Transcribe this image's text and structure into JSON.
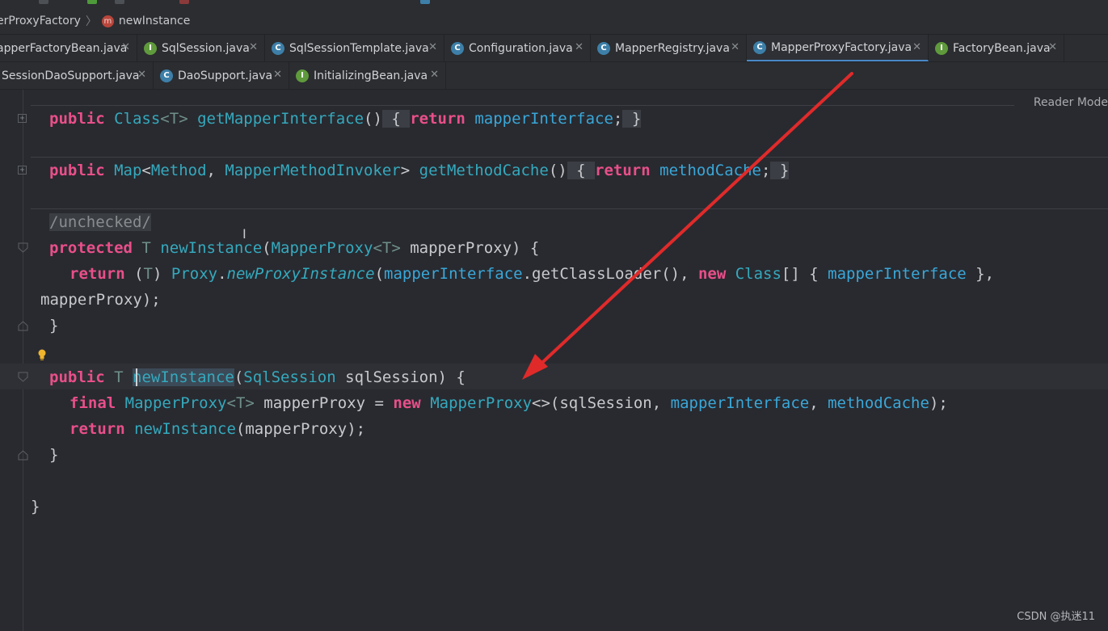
{
  "breadcrumb": {
    "class_name": "erProxyFactory",
    "method_badge": "m",
    "method_name": "newInstance"
  },
  "tabs_row1": [
    {
      "label": "apperFactoryBean.java",
      "icon": "",
      "active": false
    },
    {
      "label": "SqlSession.java",
      "icon": "I",
      "active": false
    },
    {
      "label": "SqlSessionTemplate.java",
      "icon": "C",
      "active": false
    },
    {
      "label": "Configuration.java",
      "icon": "C",
      "active": false
    },
    {
      "label": "MapperRegistry.java",
      "icon": "C",
      "active": false
    },
    {
      "label": "MapperProxyFactory.java",
      "icon": "C",
      "active": true
    },
    {
      "label": "FactoryBean.java",
      "icon": "I",
      "active": false
    }
  ],
  "tabs_row2": [
    {
      "label": "SessionDaoSupport.java",
      "icon": "",
      "active": false
    },
    {
      "label": "DaoSupport.java",
      "icon": "C",
      "active": false
    },
    {
      "label": "InitializingBean.java",
      "icon": "I",
      "active": false
    }
  ],
  "close_glyph": "✕",
  "editor": {
    "reader_mode": "Reader Mode",
    "code": {
      "l1_public": "public",
      "l1_class": "Class",
      "l1_lt": "<",
      "l1_T": "T",
      "l1_gt": ">",
      "l1_method": "getMapperInterface",
      "l1_parens": "()",
      "l1_ob": " { ",
      "l1_return": "return",
      "l1_field": "mapperInterface",
      "l1_semi": ";",
      "l1_cb": " }",
      "l2_public": "public",
      "l2_map": "Map",
      "l2_lt": "<",
      "l2_method_t": "Method",
      "l2_comma": ", ",
      "l2_invoker": "MapperMethodInvoker",
      "l2_gt": ">",
      "l2_name": "getMethodCache",
      "l2_parens": "()",
      "l2_ob": " { ",
      "l2_return": "return",
      "l2_field": "methodCache",
      "l2_semi": ";",
      "l2_cb": " }",
      "annotation": "/unchecked/",
      "l4_protected": "protected",
      "l4_T": "T",
      "l4_name": "newInstance",
      "l4_op": "(",
      "l4_type": "MapperProxy",
      "l4_generic": "<T>",
      "l4_param": " mapperProxy) {",
      "l5_return": "return",
      "l5_cast_open": " (",
      "l5_cast_T": "T",
      "l5_cast_close": ") ",
      "l5_proxy": "Proxy",
      "l5_dot": ".",
      "l5_npi": "newProxyInstance",
      "l5_open": "(",
      "l5_mi": "mapperInterface",
      "l5_gcl": ".getClassLoader(), ",
      "l5_new": "new",
      "l5_class": " Class",
      "l5_arr": "[] { ",
      "l5_mi2": "mapperInterface",
      "l5_end": " },",
      "l6": "mapperProxy);",
      "l7": "}",
      "l8_public": "public",
      "l8_T": "T",
      "l8_name": "newInstance",
      "l8_open": "(",
      "l8_type": "SqlSession",
      "l8_rest": " sqlSession) {",
      "l9_final": "final",
      "l9_type": "MapperProxy",
      "l9_generic": "<T>",
      "l9_var": " mapperProxy = ",
      "l9_new": "new",
      "l9_type2": " MapperProxy",
      "l9_diamond": "<>(sqlSession, ",
      "l9_mi": "mapperInterface",
      "l9_comma": ", ",
      "l9_mc": "methodCache",
      "l9_end": ");",
      "l10_return": "return",
      "l10_name": " newInstance",
      "l10_rest": "(mapperProxy);",
      "l11": "}",
      "l12": "}"
    }
  },
  "watermark": "CSDN @执迷11",
  "colors": {
    "keyword": "#e94f8a",
    "type": "#35a9bd",
    "field": "#3aa7d8",
    "arrow": "#e02a2a",
    "active_tab_underline": "#4a88c7"
  }
}
